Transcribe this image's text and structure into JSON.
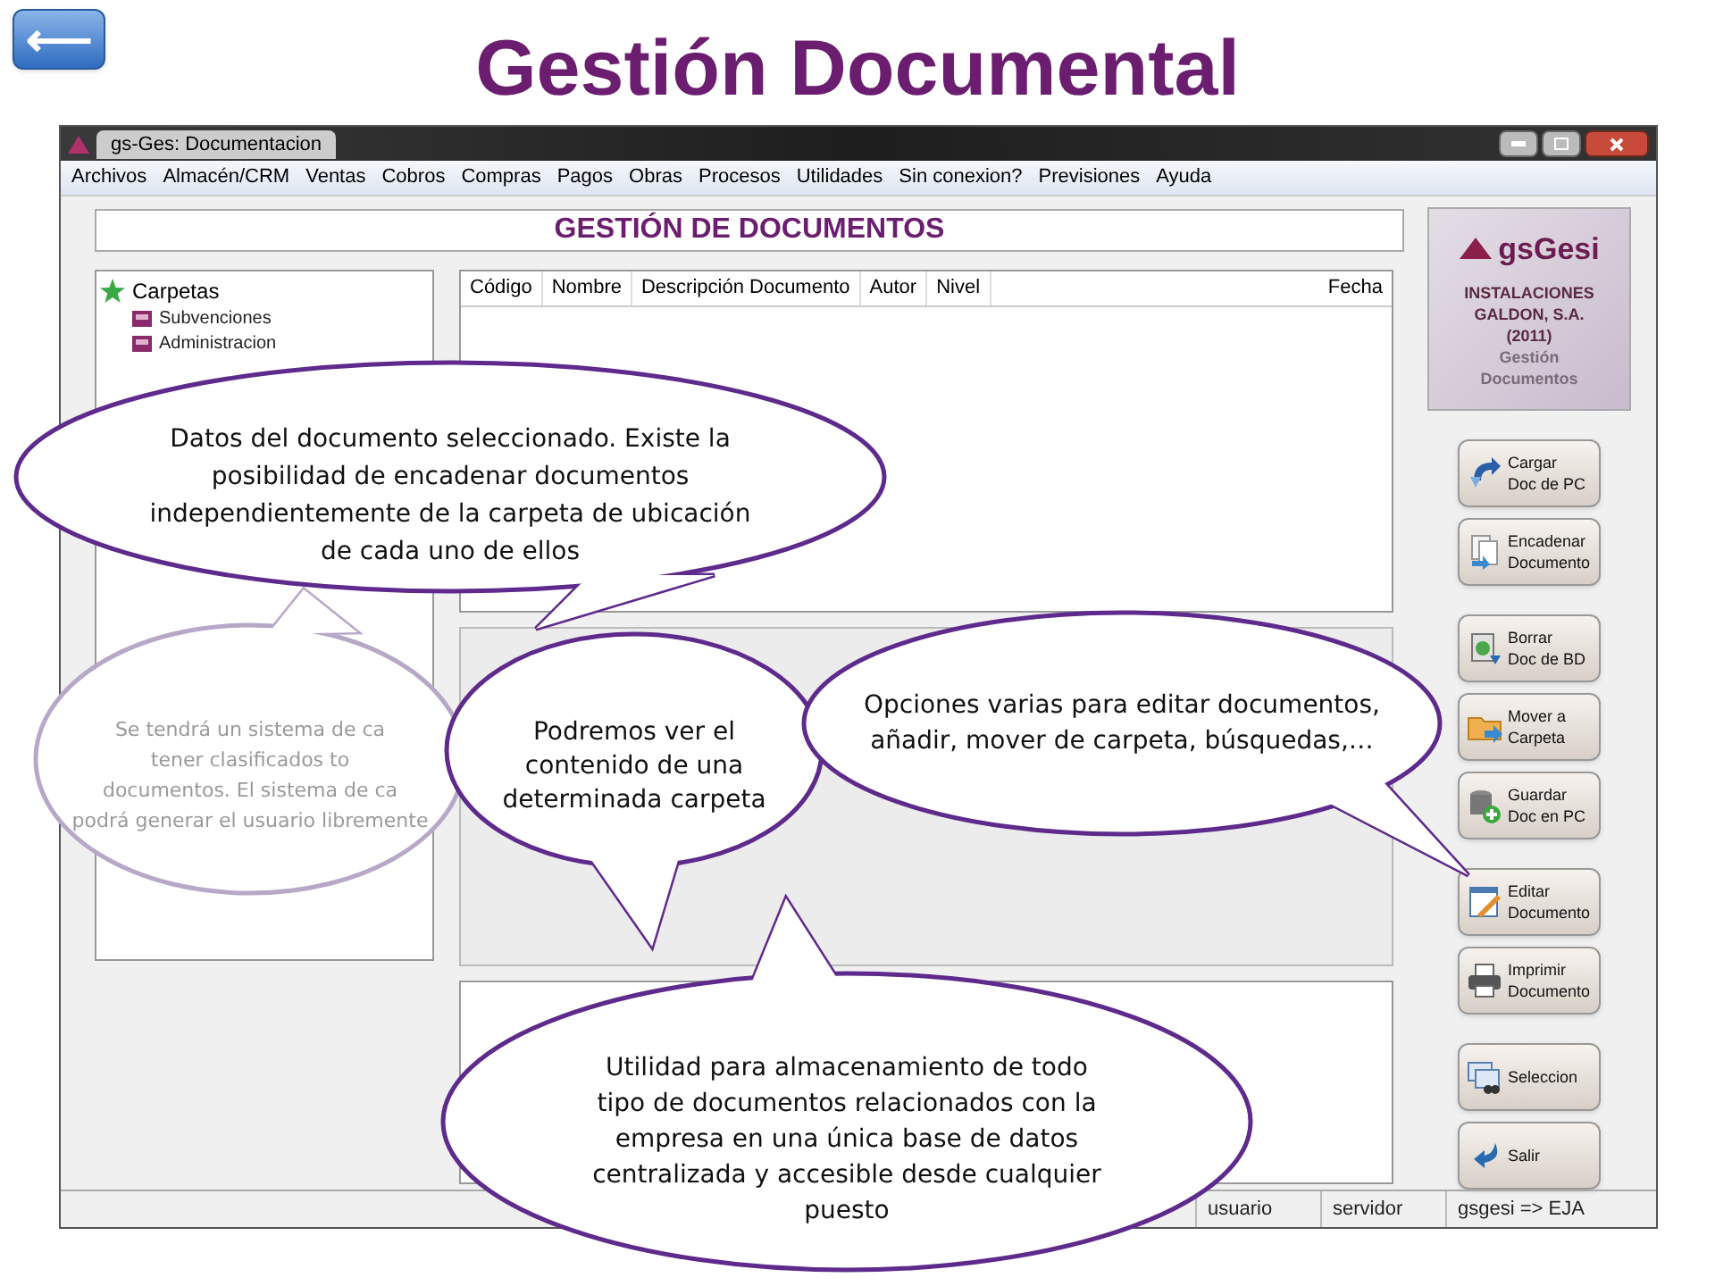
{
  "slide": {
    "title": "Gestión Documental",
    "back_button": "⟵"
  },
  "window": {
    "title": "gs-Ges: Documentacion"
  },
  "menu": [
    "Archivos",
    "Almacén/CRM",
    "Ventas",
    "Cobros",
    "Compras",
    "Pagos",
    "Obras",
    "Procesos",
    "Utilidades",
    "Sin conexion?",
    "Previsiones",
    "Ayuda"
  ],
  "header": "GESTIÓN DE DOCUMENTOS",
  "folders": {
    "label": "Carpetas",
    "children": [
      {
        "label": "Subvenciones"
      },
      {
        "label": "Administracion"
      }
    ]
  },
  "table": {
    "columns": [
      "Código",
      "Nombre",
      "Descripción Documento",
      "Autor",
      "Nivel",
      "Fecha"
    ]
  },
  "brand": {
    "logo": "gsGesi",
    "company": "INSTALACIONES\nGALDON, S.A.\n(2011)",
    "module": "Gestión\nDocumentos"
  },
  "buttons": [
    {
      "label": "Cargar\nDoc de PC",
      "kind": "upload"
    },
    {
      "label": "Encadenar\nDocumento",
      "kind": "chain"
    },
    {
      "label": "Borrar\nDoc de BD",
      "kind": "delete"
    },
    {
      "label": "Mover a\nCarpeta",
      "kind": "move"
    },
    {
      "label": "Guardar\nDoc en PC",
      "kind": "save"
    },
    {
      "label": "Editar\nDocumento",
      "kind": "edit"
    },
    {
      "label": "Imprimir\nDocumento",
      "kind": "print"
    },
    {
      "label": "Seleccion",
      "kind": "select"
    },
    {
      "label": "Salir",
      "kind": "exit"
    }
  ],
  "status_bar": [
    "usuario",
    "servidor",
    "gsgesi => EJA"
  ],
  "callouts": [
    {
      "text": "Datos del documento seleccionado. Existe la posibilidad de encadenar documentos independientemente de la carpeta de ubicación de cada uno de ellos",
      "faded": false
    },
    {
      "text": "Se tendrá un sistema de ca\ntener clasificados to\ndocumentos. El sistema de ca\npodrá generar el usuario libremente",
      "faded": true
    },
    {
      "text": "Podremos ver el contenido de una determinada carpeta",
      "faded": false
    },
    {
      "text": "Opciones varias para editar documentos, añadir, mover de carpeta, búsquedas,…",
      "faded": false
    },
    {
      "text": "Utilidad para almacenamiento de todo tipo de documentos relacionados con la empresa en una única base de datos centralizada y accesible desde cualquier puesto",
      "faded": false
    }
  ]
}
